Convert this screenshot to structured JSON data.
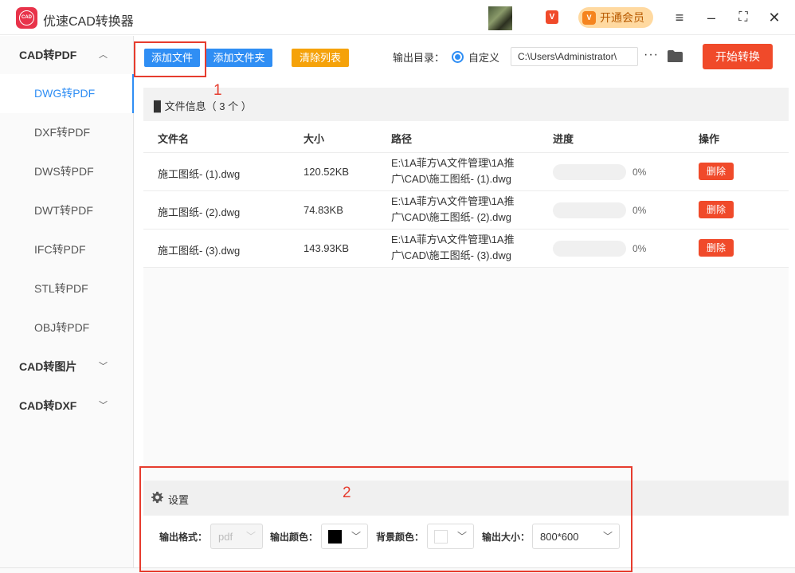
{
  "app": {
    "title": "优速CAD转换器",
    "logo_text": "CAD"
  },
  "header": {
    "vip_label": "开通会员",
    "vip_badge": "V",
    "vip_icon_text": "V"
  },
  "sidebar": {
    "groups": [
      {
        "label": "CAD转PDF",
        "chevron": "^"
      },
      {
        "label": "CAD转图片",
        "chevron": "v"
      },
      {
        "label": "CAD转DXF",
        "chevron": "v"
      }
    ],
    "items": [
      "DWG转PDF",
      "DXF转PDF",
      "DWS转PDF",
      "DWT转PDF",
      "IFC转PDF",
      "STL转PDF",
      "OBJ转PDF"
    ],
    "active": "DWG转PDF"
  },
  "toolbar": {
    "add_file": "添加文件",
    "add_folder": "添加文件夹",
    "clear_list": "清除列表",
    "output_dir_label": "输出目录：",
    "custom_label": "自定义",
    "output_path": "C:\\Users\\Administrator\\",
    "more": "···",
    "start": "开始转换"
  },
  "file_info": {
    "label": "文件信息（  3 个 ）"
  },
  "table": {
    "headers": [
      "文件名",
      "大小",
      "路径",
      "进度",
      "操作"
    ],
    "rows": [
      {
        "name": "施工图纸- (1).dwg",
        "size": "120.52KB",
        "path1": "E:\\1A菲方\\A文件管理\\1A推",
        "path2": "广\\CAD\\施工图纸- (1).dwg",
        "progress": "0%",
        "action": "删除"
      },
      {
        "name": "施工图纸- (2).dwg",
        "size": "74.83KB",
        "path1": "E:\\1A菲方\\A文件管理\\1A推",
        "path2": "广\\CAD\\施工图纸- (2).dwg",
        "progress": "0%",
        "action": "删除"
      },
      {
        "name": "施工图纸- (3).dwg",
        "size": "143.93KB",
        "path1": "E:\\1A菲方\\A文件管理\\1A推",
        "path2": "广\\CAD\\施工图纸- (3).dwg",
        "progress": "0%",
        "action": "删除"
      }
    ]
  },
  "settings": {
    "title": "设置",
    "format_label": "输出格式：",
    "format_value": "pdf",
    "color_label": "输出颜色：",
    "color_value": "#000000",
    "bg_label": "背景颜色：",
    "bg_value": "#ffffff",
    "size_label": "输出大小：",
    "size_value": "800*600"
  },
  "annotations": [
    "1",
    "2"
  ],
  "colors": {
    "accent": "#2f8ef4",
    "danger": "#f04a2a",
    "orange": "#f5a20a",
    "annotation": "#e63c2e"
  }
}
